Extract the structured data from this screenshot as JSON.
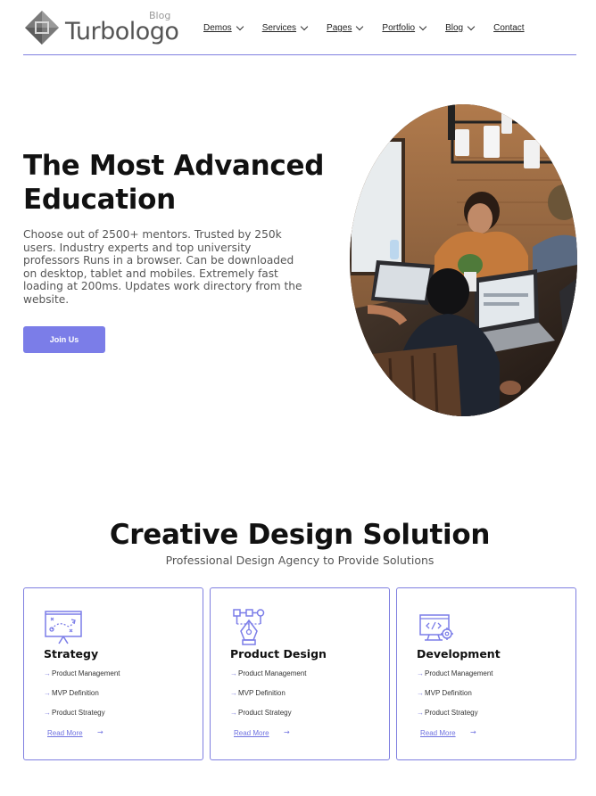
{
  "brand": {
    "name": "Turbologo",
    "sub": "Blog",
    "accent": "#7b7de8"
  },
  "nav": {
    "items": [
      {
        "label": "Demos",
        "has_dropdown": true
      },
      {
        "label": "Services",
        "has_dropdown": true
      },
      {
        "label": "Pages",
        "has_dropdown": true
      },
      {
        "label": "Portfolio",
        "has_dropdown": true
      },
      {
        "label": "Blog",
        "has_dropdown": true
      },
      {
        "label": "Contact",
        "has_dropdown": false
      }
    ]
  },
  "hero": {
    "title_line1": "The Most Advanced",
    "title_line2": "Education",
    "text": "Choose out of 2500+ mentors. Trusted by 250k users. Industry experts and top university professors Runs in a browser. Can be downloaded on desktop, tablet and mobiles. Extremely fast loading at 200ms. Updates work directory from the website.",
    "cta": "Join Us",
    "image": "team-working-on-laptops-photo"
  },
  "section": {
    "title": "Creative Design Solution",
    "subtitle": "Professional Design Agency to Provide Solutions"
  },
  "cards": [
    {
      "title": "Strategy",
      "icon": "strategy-board-icon",
      "items": [
        "Product Management",
        "MVP Definition",
        "Product Strategy"
      ],
      "link": "Read More"
    },
    {
      "title": "Product Design",
      "icon": "pen-tool-icon",
      "items": [
        "Product Management",
        "MVP Definition",
        "Product Strategy"
      ],
      "link": "Read More"
    },
    {
      "title": "Development",
      "icon": "code-monitor-icon",
      "items": [
        "Product Management",
        "MVP Definition",
        "Product Strategy"
      ],
      "link": "Read More"
    }
  ]
}
